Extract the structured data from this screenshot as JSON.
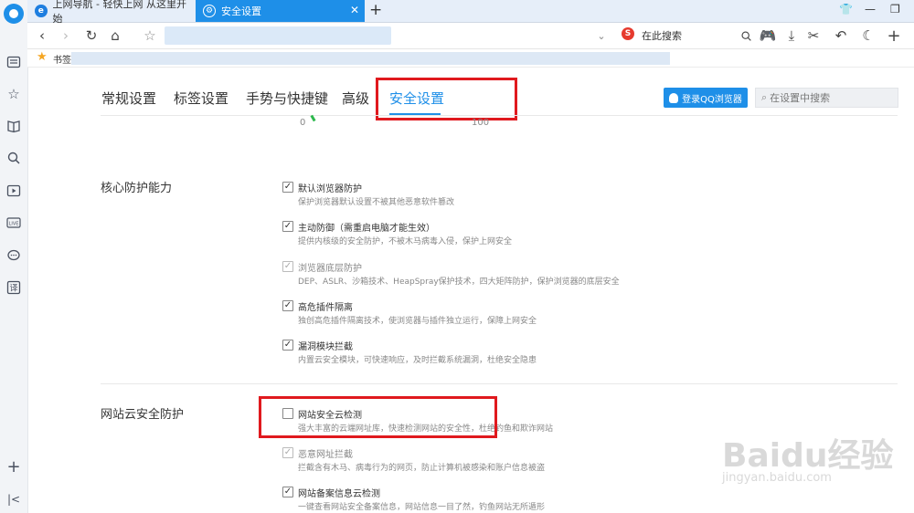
{
  "tabs": [
    {
      "label": "上网导航 - 轻快上网 从这里开始",
      "icon": "ie-icon",
      "active": false
    },
    {
      "label": "安全设置",
      "icon": "shield-icon",
      "active": true
    }
  ],
  "toolbar": {
    "search_engine": "S",
    "search_placeholder": "在此搜索"
  },
  "bookmarks": {
    "label": "书签"
  },
  "settings_nav": {
    "tabs": [
      "常规设置",
      "标签设置",
      "手势与快捷键",
      "高级",
      "安全设置"
    ],
    "active_tab": "安全设置",
    "login_label": "登录QQ浏览器",
    "search_placeholder": "在设置中搜索"
  },
  "gauge": {
    "min": "0",
    "max": "100"
  },
  "sections": [
    {
      "title": "核心防护能力",
      "options": [
        {
          "label": "默认浏览器防护",
          "desc": "保护浏览器默认设置不被其他恶意软件篡改",
          "checked": true,
          "disabled": false
        },
        {
          "label": "主动防御（需重启电脑才能生效）",
          "desc": "提供内核级的安全防护，不被木马病毒入侵，保护上网安全",
          "checked": true,
          "disabled": false
        },
        {
          "label": "浏览器底层防护",
          "desc": "DEP、ASLR、沙箱技术、HeapSpray保护技术，四大矩阵防护，保护浏览器的底层安全",
          "checked": true,
          "disabled": true
        },
        {
          "label": "高危插件隔离",
          "desc": "独创高危插件隔离技术，使浏览器与插件独立运行，保障上网安全",
          "checked": true,
          "disabled": false
        },
        {
          "label": "漏洞模块拦截",
          "desc": "内置云安全模块，可快速响应，及时拦截系统漏洞，杜绝安全隐患",
          "checked": true,
          "disabled": false
        }
      ]
    },
    {
      "title": "网站云安全防护",
      "options": [
        {
          "label": "网站安全云检测",
          "desc": "强大丰富的云端网址库，快速检测网站的安全性，杜绝钓鱼和欺诈网站",
          "checked": false,
          "disabled": false
        },
        {
          "label": "恶意网址拦截",
          "desc": "拦截含有木马、病毒行为的网页，防止计算机被感染和账户信息被盗",
          "checked": true,
          "disabled": true
        },
        {
          "label": "网站备案信息云检测",
          "desc": "一键查看网站安全备案信息，网站信息一目了然，钓鱼网站无所遁形",
          "checked": true,
          "disabled": false
        }
      ]
    }
  ],
  "watermark": {
    "brand": "Baidu经验",
    "url": "jingyan.baidu.com"
  },
  "colors": {
    "accent": "#1e8fe8",
    "highlight_box": "#e0191e",
    "tab_strip": "#e6eef9"
  }
}
